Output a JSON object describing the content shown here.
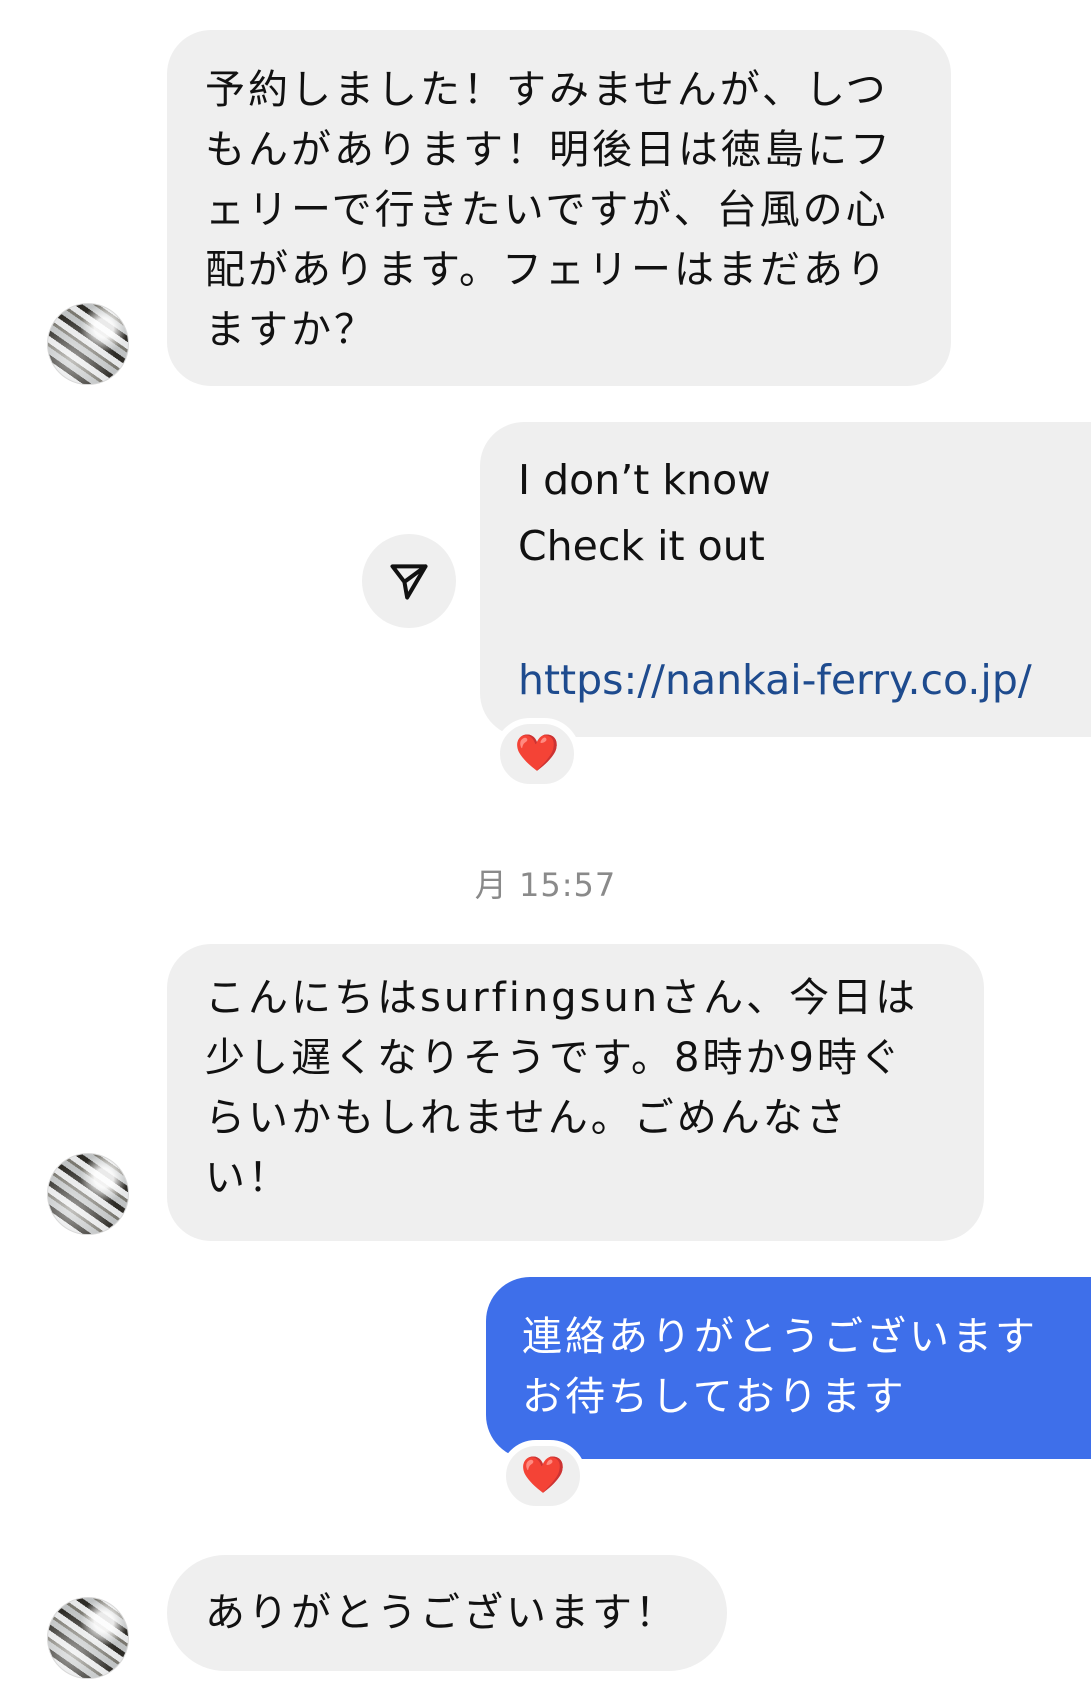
{
  "messages": [
    {
      "sender": "other",
      "text": "予約しました！すみませんが、しつ\nもんがあります！明後日は徳島にフ\nェリーで行きたいですが、台風の心\n配があります。フェリーはまだあり\nますか？"
    },
    {
      "sender": "me",
      "line1": "I don’t know",
      "line2": "Check it out",
      "link": "https://nankai-ferry.co.jp/",
      "reaction": "❤️"
    },
    {
      "sender": "other",
      "text": "こんにちはsurfingsunさん、今日は\n少し遅くなりそうです。8時か9時ぐ\nらいかもしれません。ごめんなさ\nい！"
    },
    {
      "sender": "me",
      "text": "連絡ありがとうございます\nお待ちしております",
      "reaction": "❤️"
    },
    {
      "sender": "other",
      "text": "ありがとうございます！"
    }
  ],
  "timestamp": "月 15:57",
  "colors": {
    "bubble_gray": "#efefef",
    "bubble_blue": "#3e6fea",
    "link": "#1e4b8e",
    "heart": "#e0202e"
  },
  "icons": {
    "send": "paper-plane-icon",
    "reaction": "heart-icon",
    "avatar": "avatar"
  }
}
